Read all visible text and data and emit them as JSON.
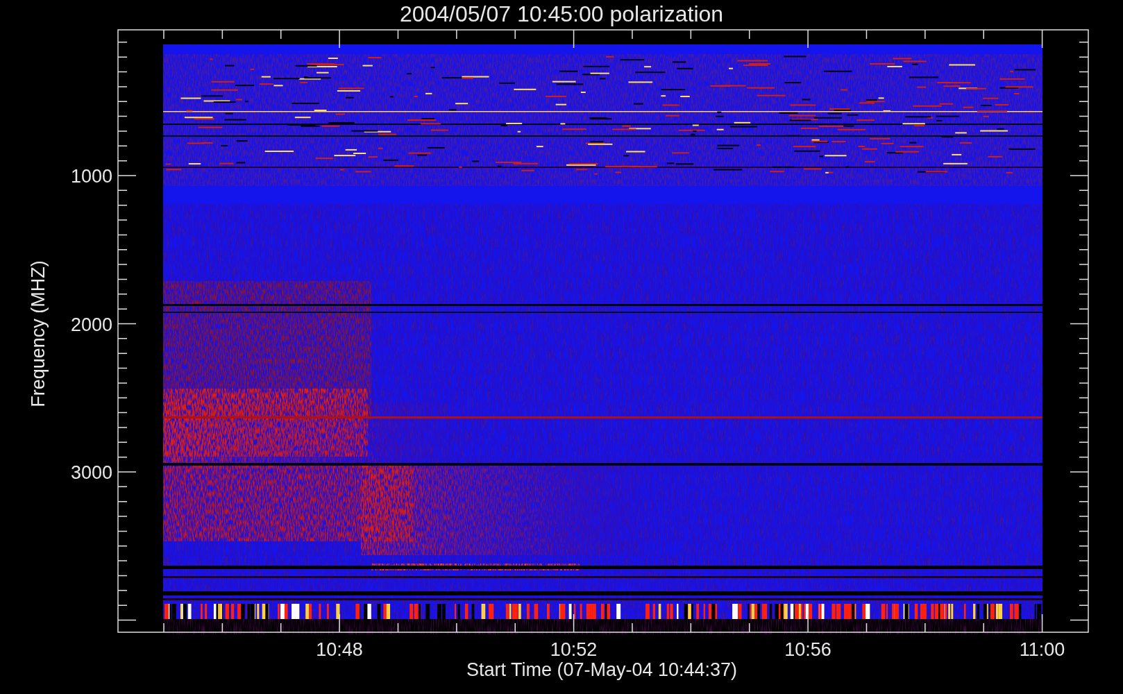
{
  "title": "2004/05/07 10:45:00 polarization",
  "plot": {
    "ylabel": "Frequency (MHZ)",
    "xlabel": "Start Time (07-May-04 10:44:37)",
    "yticks": [
      "1000",
      "2000",
      "3000"
    ],
    "xticks": [
      "10:48",
      "10:52",
      "10:56",
      "11:00"
    ]
  }
}
